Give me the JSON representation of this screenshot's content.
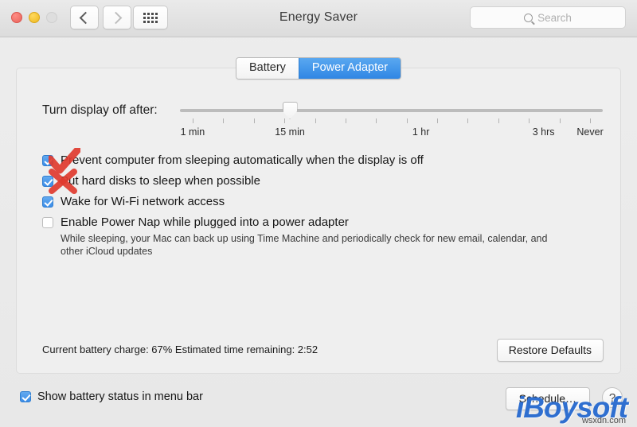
{
  "window": {
    "title": "Energy Saver",
    "traffic_lights": [
      "close",
      "minimize",
      "zoom"
    ],
    "nav": {
      "back_label": "‹",
      "forward_label": "›",
      "grid_label": "Show All"
    }
  },
  "search": {
    "placeholder": "Search",
    "value": ""
  },
  "tabs": [
    {
      "label": "Battery",
      "active": false
    },
    {
      "label": "Power Adapter",
      "active": true
    }
  ],
  "slider": {
    "label": "Turn display off after:",
    "value": "15 min",
    "thumb_percent": 26,
    "tick_count": 14,
    "tick_labels": [
      {
        "text": "1 min",
        "percent": 3
      },
      {
        "text": "15 min",
        "percent": 26
      },
      {
        "text": "1 hr",
        "percent": 57
      },
      {
        "text": "3 hrs",
        "percent": 86
      },
      {
        "text": "Never",
        "percent": 97
      }
    ]
  },
  "options": [
    {
      "label": "Prevent computer from sleeping automatically when the display is off",
      "checked": true,
      "annotation": "red-check"
    },
    {
      "label": "Put hard disks to sleep when possible",
      "checked": true,
      "annotation": "red-cross"
    },
    {
      "label": "Wake for Wi-Fi network access",
      "checked": true,
      "annotation": "none"
    },
    {
      "label": "Enable Power Nap while plugged into a power adapter",
      "checked": false,
      "annotation": "none",
      "description": "While sleeping, your Mac can back up using Time Machine and periodically check for new email, calendar, and other iCloud updates"
    }
  ],
  "footer": {
    "battery_status": "Current battery charge: 67%  Estimated time remaining: 2:52",
    "restore_defaults_label": "Restore Defaults"
  },
  "bottom_bar": {
    "show_battery_label": "Show battery status in menu bar",
    "show_battery_checked": true,
    "schedule_label": "Schedule…",
    "help_label": "?"
  },
  "watermark": {
    "brand": "iBoysoft",
    "source": "wsxdn.com"
  },
  "colors": {
    "accent_blue": "#3c8de8",
    "annotation_red": "#e03b2f",
    "window_bg": "#ececec",
    "panel_bg": "#efefef"
  }
}
